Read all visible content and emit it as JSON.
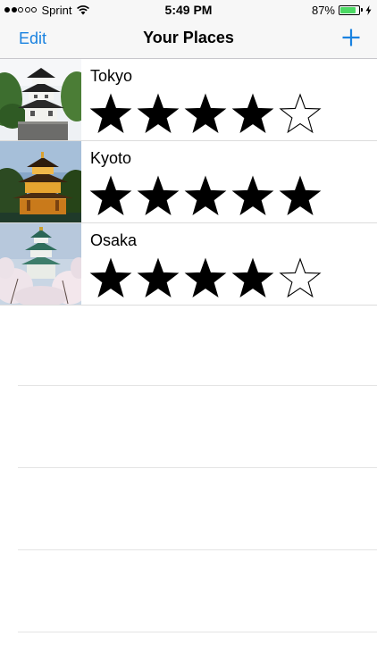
{
  "status_bar": {
    "signal_bars_filled": 2,
    "signal_bars_total": 5,
    "carrier": "Sprint",
    "time": "5:49 PM",
    "battery_percent": "87%",
    "battery_level": 0.87,
    "battery_color": "#4cd964"
  },
  "navbar": {
    "edit_label": "Edit",
    "title": "Your Places",
    "add_icon": "plus-icon",
    "tint_color": "#1a82e0"
  },
  "places": [
    {
      "name": "Tokyo",
      "rating": 4,
      "max_rating": 5,
      "thumbnail": "japanese-castle-tower"
    },
    {
      "name": "Kyoto",
      "rating": 5,
      "max_rating": 5,
      "thumbnail": "golden-pavilion"
    },
    {
      "name": "Osaka",
      "rating": 4,
      "max_rating": 5,
      "thumbnail": "castle-with-cherry-blossoms"
    }
  ]
}
